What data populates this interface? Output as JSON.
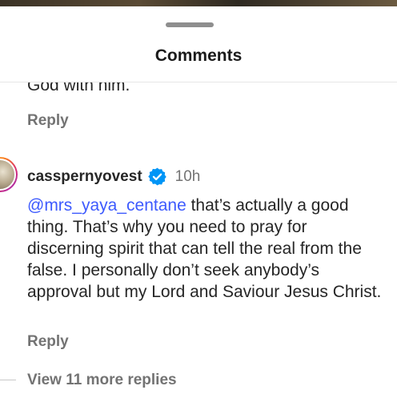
{
  "header": {
    "title": "Comments"
  },
  "previous_comment": {
    "text_tail": "God with him.",
    "reply_label": "Reply"
  },
  "comment": {
    "username": "casspernyovest",
    "verified": true,
    "time": "10h",
    "mention": "@mrs_yaya_centane",
    "text": " that’s actually a good thing. That’s why you need to pray for discerning spirit that can tell the real from the false. I personally don’t seek anybody’s approval but my Lord and Saviour Jesus Christ.",
    "reply_label": "Reply",
    "view_more_label": "View 11 more replies"
  },
  "colors": {
    "mention": "#3d5afe",
    "verified": "#0095f6",
    "muted": "#737373"
  }
}
